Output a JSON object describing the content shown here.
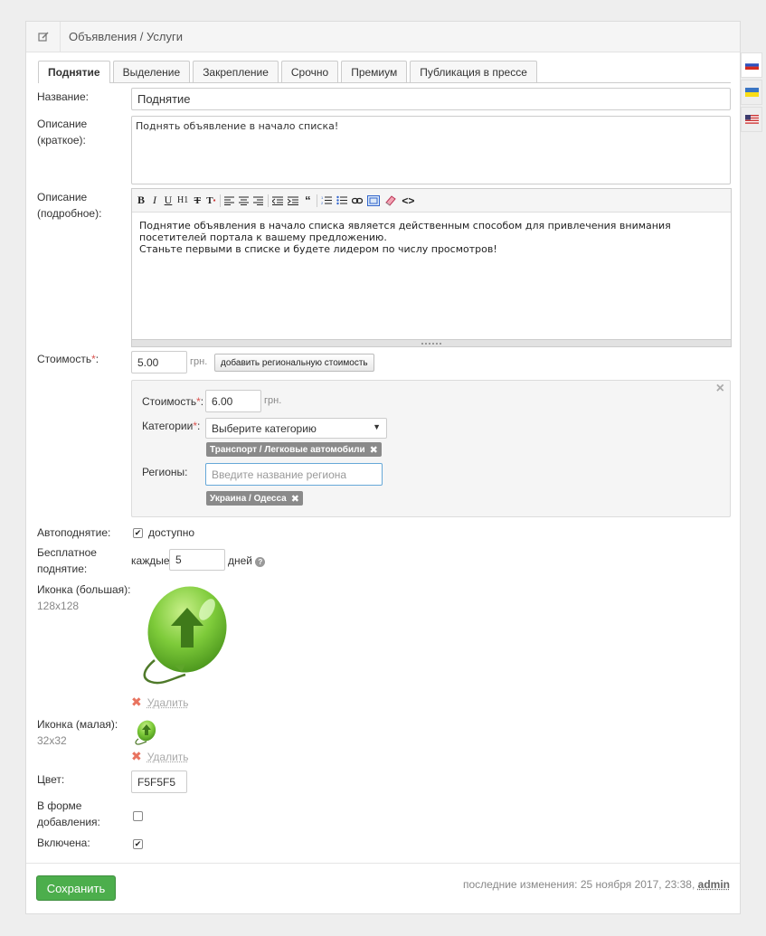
{
  "header": {
    "title": "Объявления / Услуги"
  },
  "tabs": [
    {
      "label": "Поднятие",
      "active": true
    },
    {
      "label": "Выделение",
      "active": false
    },
    {
      "label": "Закрепление",
      "active": false
    },
    {
      "label": "Срочно",
      "active": false
    },
    {
      "label": "Премиум",
      "active": false
    },
    {
      "label": "Публикация в прессе",
      "active": false
    }
  ],
  "form": {
    "name_label": "Название:",
    "name_value": "Поднятие",
    "short_desc_label_1": "Описание",
    "short_desc_label_2": "(краткое):",
    "short_desc_value": "Поднять объявление в начало списка!",
    "full_desc_label_1": "Описание",
    "full_desc_label_2": "(подробное):",
    "full_desc_line1": "Поднятие объявления в начало списка является действенным способом для привлечения внимания посетителей портала к вашему предложению.",
    "full_desc_line2": "Станьте первыми в списке и будете лидером по числу просмотров!",
    "toolbar": {
      "bold": "B",
      "italic": "I",
      "underline": "U",
      "h1": "H1",
      "strike": "T",
      "quote": "“",
      "more": "<>"
    },
    "price_label": "Стоимость",
    "price_required": "*",
    "price_colon": ":",
    "price_value": "5.00",
    "currency": "грн.",
    "add_regional_price": "добавить региональную стоимость",
    "regional": {
      "price_label": "Стоимость",
      "price_value": "6.00",
      "currency": "грн.",
      "category_label": "Категории",
      "category_placeholder": "Выберите категорию",
      "category_tag": "Транспорт / Легковые автомобили",
      "regions_label": "Регионы:",
      "regions_placeholder": "Введите название региона",
      "region_tag": "Украина / Одесса",
      "close": "×"
    },
    "autoraise_label": "Автоподнятие:",
    "autoraise_option": "доступно",
    "autoraise_checked": true,
    "free_raise_label_1": "Бесплатное",
    "free_raise_label_2": "поднятие:",
    "free_every": "каждые",
    "free_days_value": "5",
    "free_days": "дней",
    "icon_big_label": "Иконка (большая):",
    "icon_big_size": "128x128",
    "icon_small_label": "Иконка (малая):",
    "icon_small_size": "32x32",
    "delete_label": "Удалить",
    "color_label": "Цвет:",
    "color_value": "F5F5F5",
    "in_add_form_label_1": "В форме",
    "in_add_form_label_2": "добавления:",
    "in_add_form_checked": false,
    "enabled_label": "Включена:",
    "enabled_checked": true
  },
  "footer": {
    "save": "Сохранить",
    "modified_text": "последние изменения: 25 ноября 2017, 23:38,",
    "modified_user": "admin"
  },
  "colors": {
    "save_green": "#4cae4c",
    "required_red": "#d9534f",
    "balloon_green": "#7ecb3a"
  },
  "languages": [
    "ru-flag-icon",
    "ua-flag-icon",
    "us-flag-icon"
  ]
}
